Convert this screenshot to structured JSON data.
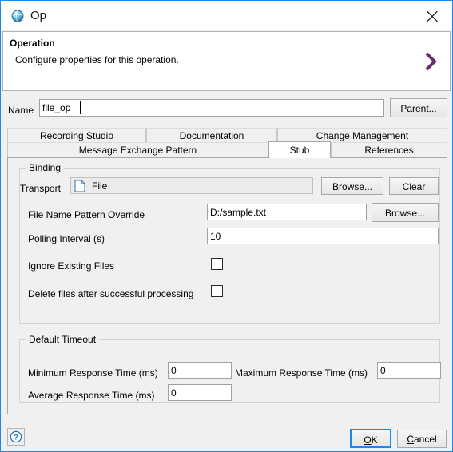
{
  "window": {
    "title": "Op",
    "title_icon": "globe-icon",
    "close_icon": "close-icon",
    "accent_color": "#1a8ae5"
  },
  "header": {
    "title": "Operation",
    "description": "Configure properties for this operation.",
    "chevron_icon": "chevron-right-icon",
    "chevron_color": "#6b2c6b"
  },
  "name_row": {
    "label": "Name",
    "value": "file_op",
    "parent_button": "Parent..."
  },
  "tabs": {
    "row1": [
      {
        "label": "Recording Studio",
        "selected": false
      },
      {
        "label": "Documentation",
        "selected": false
      },
      {
        "label": "Change Management",
        "selected": false
      }
    ],
    "row2": [
      {
        "label": "Message Exchange Pattern",
        "selected": false
      },
      {
        "label": "Stub",
        "selected": true
      },
      {
        "label": "References",
        "selected": false
      }
    ]
  },
  "binding": {
    "group_title": "Binding",
    "transport": {
      "label": "Transport",
      "icon": "file-document-icon",
      "value": "File",
      "browse_button": "Browse...",
      "clear_button": "Clear"
    },
    "file_name_pattern_override": {
      "label": "File Name Pattern Override",
      "value": "D:/sample.txt",
      "browse_button": "Browse..."
    },
    "polling_interval": {
      "label": "Polling Interval (s)",
      "value": "10"
    },
    "ignore_existing_files": {
      "label": "Ignore Existing Files",
      "checked": false
    },
    "delete_files_after_processing": {
      "label": "Delete files after successful processing",
      "checked": false
    }
  },
  "default_timeout": {
    "group_title": "Default Timeout",
    "minimum_response_time": {
      "label": "Minimum Response Time (ms)",
      "value": "0"
    },
    "maximum_response_time": {
      "label": "Maximum Response Time (ms)",
      "value": "0"
    },
    "average_response_time": {
      "label": "Average Response Time (ms)",
      "value": "0"
    }
  },
  "footer": {
    "help_icon": "help-question-icon",
    "ok": {
      "mnemonic": "O",
      "rest": "K"
    },
    "cancel": {
      "mnemonic": "C",
      "rest": "ancel"
    }
  }
}
